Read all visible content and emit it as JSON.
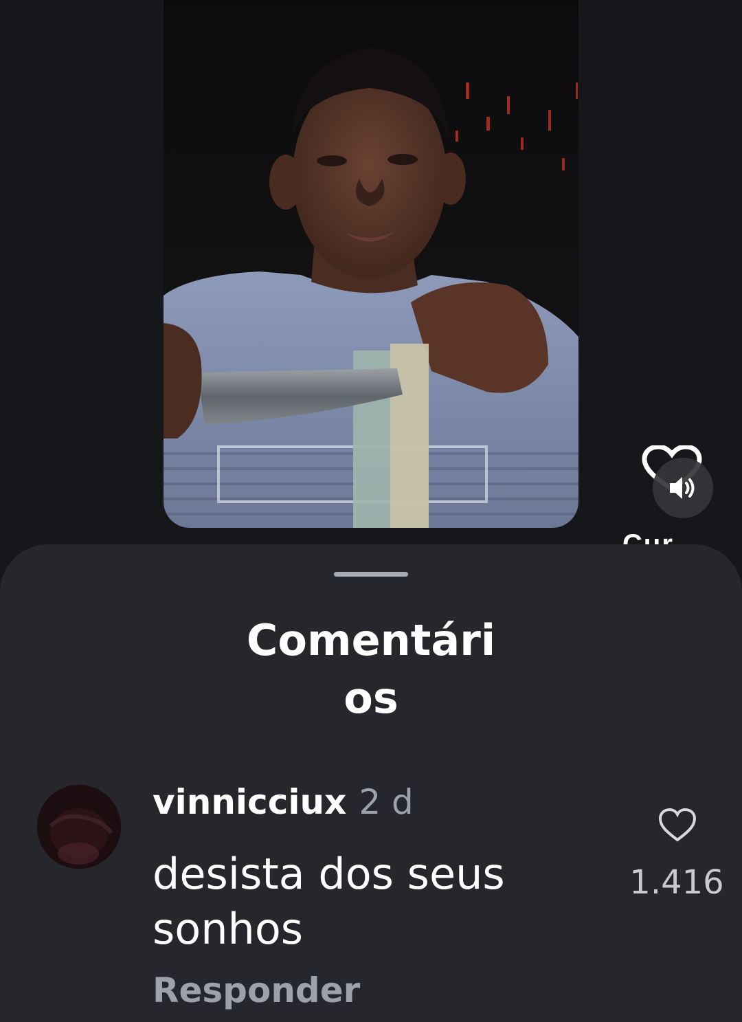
{
  "video": {
    "alt": "",
    "sound_label": "sound"
  },
  "side_actions": {
    "partial_label": "Cur..."
  },
  "comments_sheet": {
    "title": "Comentários",
    "comments": [
      {
        "username": "vinnicciux",
        "timestamp": "2 d",
        "text": "desista dos seus sonhos",
        "reply_label": "Responder",
        "like_count": "1.416"
      }
    ]
  },
  "colors": {
    "background": "#15171b",
    "sheet": "#25272c",
    "text_primary": "#ffffff",
    "text_secondary": "#9ea1a7"
  }
}
